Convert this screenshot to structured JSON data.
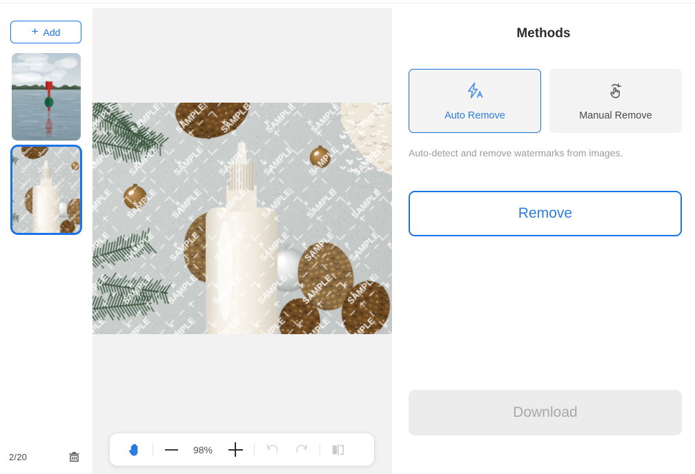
{
  "sidebar": {
    "add_button_label": "Add",
    "add_icon": "plus-icon",
    "thumbnails": [
      {
        "alt": "Red buoy floating on a calm lake with a tree line on the horizon",
        "selected": false
      },
      {
        "alt": "White dropper bottle on a gray surface with pine cones, branches and silver ornaments, covered with SAMPLE watermarks",
        "selected": true
      }
    ],
    "counter": "2/20",
    "delete_icon": "trash-icon"
  },
  "canvas": {
    "image_alt": "White cosmetic dropper bottle flat-lay with pine cones, fir branches and silver baubles on a gray concrete surface, overlaid with diagonal SAMPLE watermark text",
    "watermark_text": "SAMPLE",
    "toolbar": {
      "pan_icon": "hand-icon",
      "zoom_out_icon": "minus-icon",
      "zoom_level": "98%",
      "zoom_in_icon": "plus-icon",
      "undo_icon": "undo-icon",
      "redo_icon": "redo-icon",
      "compare_icon": "compare-split-icon"
    }
  },
  "panel": {
    "title": "Methods",
    "methods": [
      {
        "label": "Auto Remove",
        "icon": "lightning-auto-icon",
        "active": true
      },
      {
        "label": "Manual Remove",
        "icon": "hand-tap-icon",
        "active": false
      }
    ],
    "method_description": "Auto-detect and remove watermarks from images.",
    "remove_button_label": "Remove",
    "download_button_label": "Download"
  },
  "colors": {
    "accent_blue": "#1a73e8",
    "text_blue": "#2b7de0",
    "canvas_bg": "#f2f2f2",
    "card_bg": "#f3f3f3",
    "disabled_bg": "#ececec",
    "disabled_text": "#a8a8a8",
    "muted_text": "#9b9b9b"
  }
}
